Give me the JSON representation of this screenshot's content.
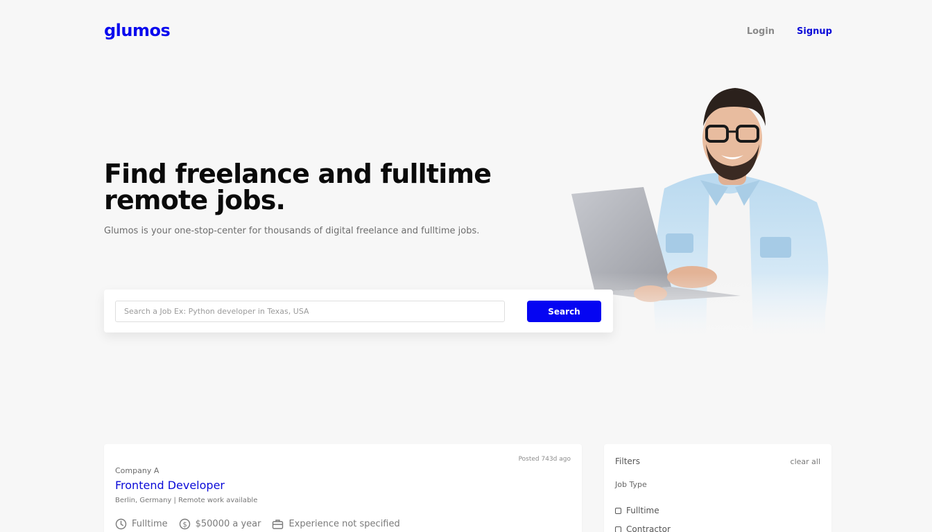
{
  "nav": {
    "logo": "glumos",
    "login": "Login",
    "signup": "Signup"
  },
  "hero": {
    "title_line1": "Find freelance and fulltime",
    "title_line2": "remote jobs.",
    "subtitle": "Glumos is your one-stop-center for thousands of digital freelance and fulltime jobs."
  },
  "search": {
    "placeholder": "Search a Job Ex: Python developer in Texas, USA",
    "value": "",
    "button": "Search"
  },
  "jobs": [
    {
      "posted": "Posted 743d ago",
      "company": "Company A",
      "title": "Frontend Developer",
      "location": "Berlin, Germany | Remote work available",
      "type": "Fulltime",
      "salary": "$50000 a year",
      "experience": "Experience not specified"
    }
  ],
  "filters": {
    "title": "Filters",
    "clear": "clear all",
    "job_type_label": "Job Type",
    "options": [
      "Fulltime",
      "Contractor"
    ]
  },
  "colors": {
    "brand": "#0a0aee",
    "button": "#0505f2",
    "background": "#f7f7f7"
  },
  "icons": [
    "clock-icon",
    "dollar-icon",
    "briefcase-icon"
  ]
}
